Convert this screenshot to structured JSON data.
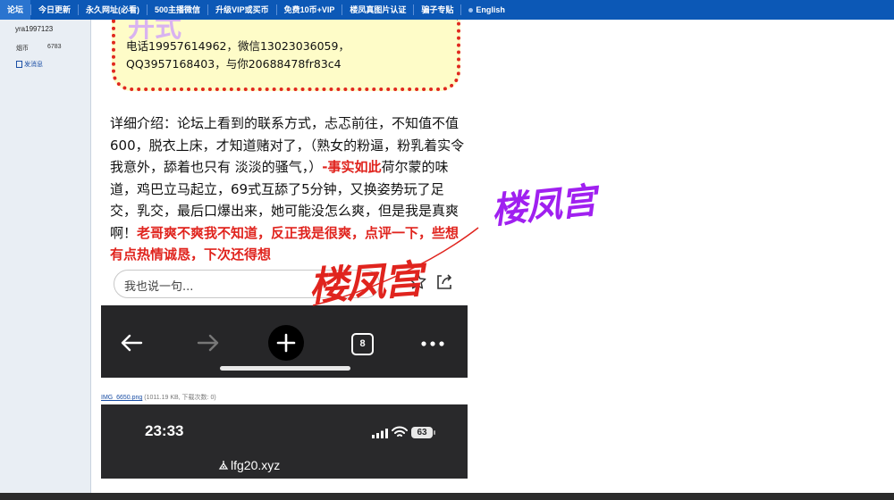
{
  "nav": {
    "items": [
      "论坛",
      "今日更新",
      "永久网址(必看)",
      "500主播微信",
      "升级VIP或买币",
      "免费10币+VIP",
      "楼凤真图片认证",
      "骗子专贴",
      "English"
    ]
  },
  "sidebar": {
    "username": "yra1997123",
    "coin_label": "烟币",
    "coin_value": "6783",
    "message_link": "发消息"
  },
  "notice": {
    "contact_text": "电话19957614962，微信13023036059，QQ3957168403，与你20688478fr83c4"
  },
  "article": {
    "part1": "详细介绍：论坛上看到的联系方式，忐忑前往，不知值不值600，脱衣上床，才知道赌对了，（熟女的粉逼，粉乳着实令我意外，舔着也只有 淡淡的骚气，）",
    "red1": "-事实如此",
    "part2": "荷尔蒙的味道，鸡巴立马起立，69式互舔了5分钟，又换姿势玩了足交，乳交，最后口爆出来，她可能没怎么爽，但是我是真爽啊！",
    "red2": "老哥爽不爽我不知道，反正我是很爽，点评一下，些想有点热情诚恳，下次还得想"
  },
  "comment_bar": {
    "placeholder": "我也说一句..."
  },
  "browser": {
    "tab_count": "8"
  },
  "attachment": {
    "filename": "IMG_6650.png",
    "meta": "(1011.19 KB, 下载次数: 0)"
  },
  "status_bar": {
    "time": "23:33",
    "battery": "63",
    "url": "lfg20.xyz"
  },
  "watermarks": {
    "purple": "楼凤宫",
    "red": "楼凤宫"
  },
  "colors": {
    "nav_bg": "#0c58b6",
    "red_text": "#e0241e",
    "watermark_purple": "#a020f0"
  }
}
